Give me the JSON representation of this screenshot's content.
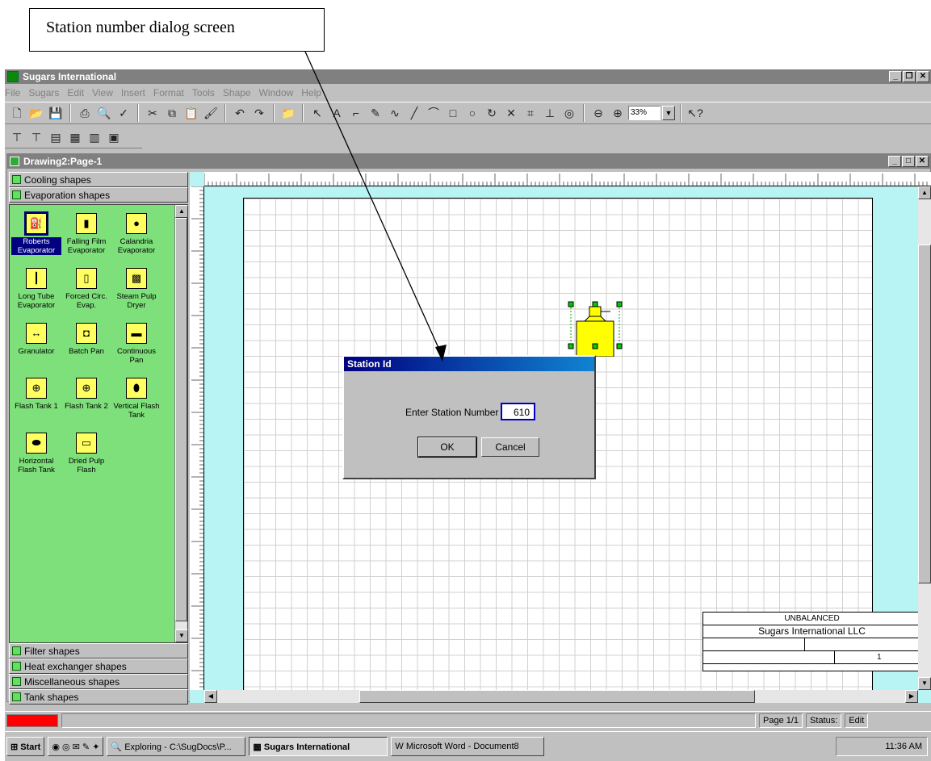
{
  "callout": {
    "text": "Station number dialog screen"
  },
  "app": {
    "title": "Sugars International",
    "menu": [
      "File",
      "Sugars",
      "Edit",
      "View",
      "Insert",
      "Format",
      "Tools",
      "Shape",
      "Window",
      "Help"
    ],
    "zoom": "33%"
  },
  "document": {
    "title": "Drawing2:Page-1"
  },
  "stencil": {
    "top_tabs": [
      "Cooling shapes",
      "Evaporation shapes"
    ],
    "shapes": [
      {
        "label": "Roberts Evaporator",
        "selected": true
      },
      {
        "label": "Falling Film Evaporator"
      },
      {
        "label": "Calandria Evaporator"
      },
      {
        "label": "Long Tube Evaporator"
      },
      {
        "label": "Forced Circ. Evap."
      },
      {
        "label": "Steam Pulp Dryer"
      },
      {
        "label": "Granulator"
      },
      {
        "label": "Batch Pan"
      },
      {
        "label": "Continuous Pan"
      },
      {
        "label": "Flash Tank 1"
      },
      {
        "label": "Flash Tank 2"
      },
      {
        "label": "Vertical Flash Tank"
      },
      {
        "label": "Horizontal Flash Tank"
      },
      {
        "label": "Dried Pulp Flash"
      }
    ],
    "bottom_tabs": [
      "Filter shapes",
      "Heat exchanger shapes",
      "Miscellaneous shapes",
      "Tank shapes"
    ]
  },
  "title_block": {
    "line1": "UNBALANCED",
    "line2": "Sugars International LLC",
    "page_no": "1"
  },
  "dialog": {
    "title": "Station Id",
    "label": "Enter Station Number",
    "value": "610",
    "ok": "OK",
    "cancel": "Cancel"
  },
  "status": {
    "page": "Page 1/1",
    "status_label": "Status:",
    "status_value": "Edit"
  },
  "taskbar": {
    "start": "Start",
    "items": [
      "Exploring - C:\\SugDocs\\P...",
      "Sugars International",
      "Microsoft Word - Document8"
    ],
    "clock": "11:36 AM"
  }
}
